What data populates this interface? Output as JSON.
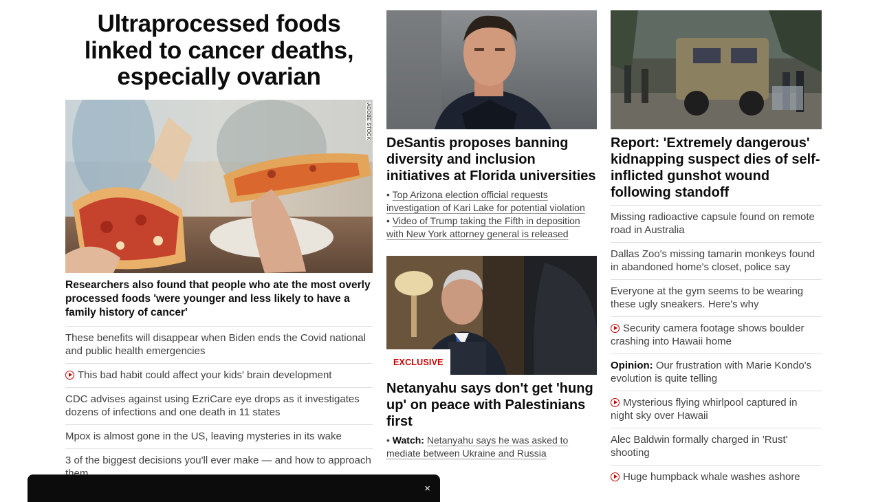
{
  "hero": {
    "title": "Ultraprocessed foods linked to cancer deaths, especially ovarian",
    "image_credit": "ADOBE STOCK",
    "lead": "Researchers also found that people who ate the most overly processed foods 'were younger and less likely to have a family history of cancer'"
  },
  "left_list": [
    {
      "text": "These benefits will disappear when Biden ends the Covid national and public health emergencies",
      "video": false
    },
    {
      "text": "This bad habit could affect your kids' brain development",
      "video": true
    },
    {
      "text": "CDC advises against using EzriCare eye drops as it investigates dozens of infections and one death in 11 states",
      "video": false
    },
    {
      "text": "Mpox is almost gone in the US, leaving mysteries in its wake",
      "video": false
    },
    {
      "text": "3 of the biggest decisions you'll ever make — and how to approach them",
      "video": false
    }
  ],
  "middle": {
    "story1": {
      "headline": "DeSantis proposes banning diversity and inclusion initiatives at Florida universities",
      "bullet": "•",
      "links": [
        "Top Arizona election official requests investigation of Kari Lake for potential violation",
        "Video of Trump taking the Fifth in deposition with New York attorney general is released"
      ]
    },
    "story2": {
      "badge": "EXCLUSIVE",
      "headline": "Netanyahu says don't get 'hung up' on peace with Palestinians first",
      "bullet": "•",
      "link_prefix": "Watch:",
      "link": "Netanyahu says he was asked to mediate between Ukraine and Russia"
    }
  },
  "right": {
    "headline": "Report: 'Extremely dangerous' kidnapping suspect dies of self-inflicted gunshot wound following standoff",
    "list": [
      {
        "prefix": "",
        "text": "Missing radioactive capsule found on remote road in Australia",
        "video": false
      },
      {
        "prefix": "",
        "text": "Dallas Zoo's missing tamarin monkeys found in abandoned home's closet, police say",
        "video": false
      },
      {
        "prefix": "",
        "text": "Everyone at the gym seems to be wearing these ugly sneakers. Here's why",
        "video": false
      },
      {
        "prefix": "",
        "text": "Security camera footage shows boulder crashing into Hawaii home",
        "video": true
      },
      {
        "prefix": "Opinion:",
        "text": " Our frustration with Marie Kondo's evolution is quite telling",
        "video": false
      },
      {
        "prefix": "",
        "text": "Mysterious flying whirlpool captured in night sky over Hawaii",
        "video": true
      },
      {
        "prefix": "",
        "text": "Alec Baldwin formally charged in 'Rust' shooting",
        "video": false
      },
      {
        "prefix": "",
        "text": "Huge humpback whale washes ashore",
        "video": true
      }
    ]
  },
  "bottom_bar": {
    "close_glyph": "×"
  },
  "colors": {
    "accent_red": "#cc0000",
    "text": "#0c0c0c",
    "secondary_text": "#404040",
    "divider": "#e0e0e0"
  }
}
